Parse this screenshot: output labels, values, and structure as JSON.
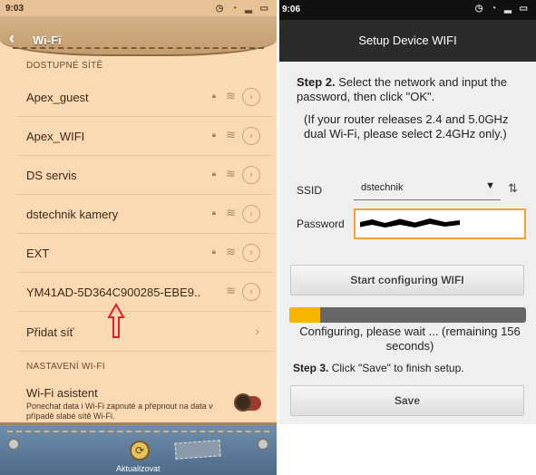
{
  "left_phone": {
    "status_time": "9:03",
    "header_title": "Wi-Fi",
    "section_available": "DOSTUPNÉ SÍTĚ",
    "networks": [
      {
        "name": "Apex_guest",
        "locked": true
      },
      {
        "name": "Apex_WIFI",
        "locked": true
      },
      {
        "name": "DS servis",
        "locked": true
      },
      {
        "name": "dstechnik kamery",
        "locked": true
      },
      {
        "name": "EXT",
        "locked": true
      },
      {
        "name": "YM41AD-5D364C900285-EBE9..",
        "locked": false
      }
    ],
    "add_network_label": "Přidat síť",
    "section_settings": "NASTAVENÍ WI-FI",
    "assistant_title": "Wi-Fi asistent",
    "assistant_desc": "Ponechat data i Wi-Fi zapnuté a přepnout na data v případě slabé sítě Wi-Fi.",
    "update_label": "Aktualizovat",
    "colors": {
      "background": "#fbd9b3",
      "arrow": "#e02020",
      "toggle": "#a03a2c"
    }
  },
  "right_phone": {
    "status_time": "9:06",
    "header_title": "Setup Device WIFI",
    "step2_bold": "Step 2.",
    "step2_text": " Select the network and input the password, then click \"OK\".",
    "router_note": "(If your router releases 2.4 and 5.0GHz dual Wi-Fi, please select 2.4GHz only.)",
    "ssid_label": "SSID",
    "ssid_value": "dstechnik",
    "password_label": "Password",
    "start_button": "Start configuring WIFI",
    "progress_fraction": 0.13,
    "configuring_text": "Configuring, please wait ... (remaining 156 seconds)",
    "step3_bold": "Step 3.",
    "step3_text": " Click \"Save\" to finish setup.",
    "save_button": "Save",
    "colors": {
      "header": "#2b2b2b",
      "progress_fill": "#f5b400",
      "input_border": "#f0a330"
    }
  }
}
